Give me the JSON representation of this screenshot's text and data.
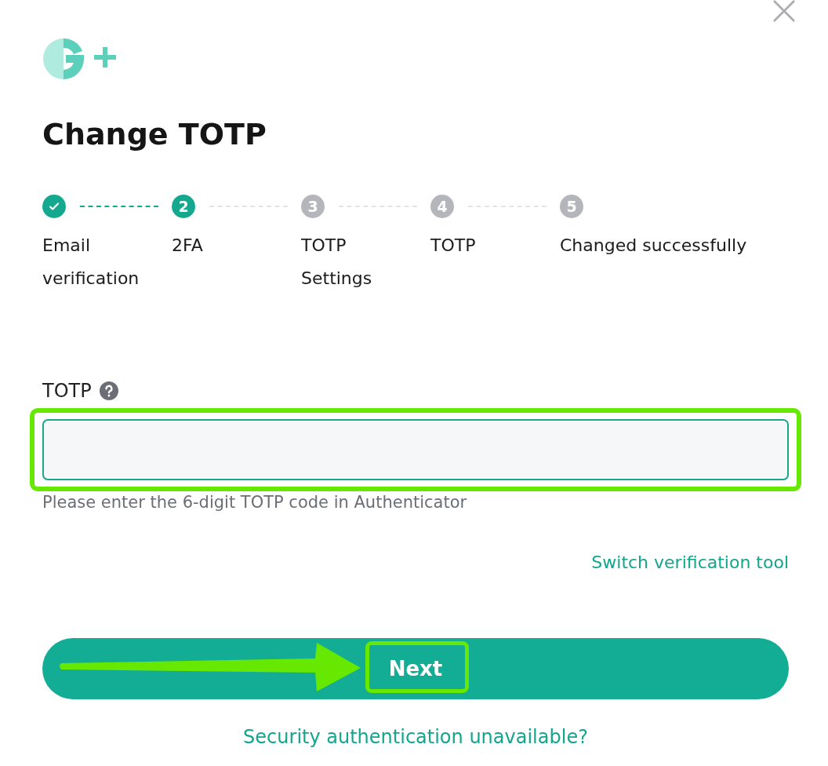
{
  "dialog": {
    "title": "Change TOTP"
  },
  "steps": [
    {
      "completed": true,
      "selected": false,
      "label": "Email verification"
    },
    {
      "completed": false,
      "selected": true,
      "number": "2",
      "label": "2FA"
    },
    {
      "completed": false,
      "selected": false,
      "number": "3",
      "label": "TOTP Settings"
    },
    {
      "completed": false,
      "selected": false,
      "number": "4",
      "label": "TOTP"
    },
    {
      "completed": false,
      "selected": false,
      "number": "5",
      "label": "Changed successfully"
    }
  ],
  "field": {
    "label": "TOTP",
    "hint": "Please enter the 6-digit TOTP code in Authenticator"
  },
  "switch_link": "Switch verification tool",
  "next_button": "Next",
  "help_link": "Security authentication unavailable?"
}
